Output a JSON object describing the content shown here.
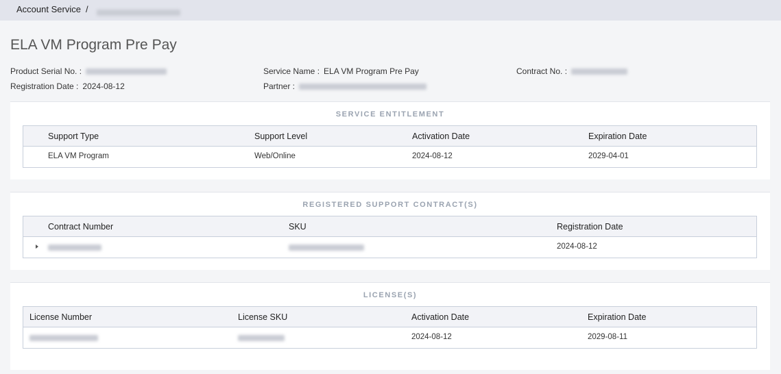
{
  "breadcrumb": {
    "root": "Account Service",
    "separator": "/"
  },
  "page_title": "ELA VM Program Pre Pay",
  "info": {
    "serial_label": "Product Serial No. :",
    "registration_label": "Registration Date :",
    "registration_value": "2024-08-12",
    "service_label": "Service Name :",
    "service_value": "ELA VM Program Pre Pay",
    "partner_label": "Partner :",
    "contract_label": "Contract No. :"
  },
  "entitlement": {
    "title": "SERVICE ENTITLEMENT",
    "headers": [
      "Support Type",
      "Support Level",
      "Activation Date",
      "Expiration Date"
    ],
    "rows": [
      [
        "ELA VM Program",
        "Web/Online",
        "2024-08-12",
        "2029-04-01"
      ]
    ]
  },
  "contracts": {
    "title": "REGISTERED SUPPORT CONTRACT(S)",
    "headers": [
      "Contract Number",
      "SKU",
      "Registration Date"
    ],
    "rows": [
      [
        "2024-08-12"
      ]
    ]
  },
  "licenses": {
    "title": "LICENSE(S)",
    "headers": [
      "License Number",
      "License SKU",
      "Activation Date",
      "Expiration Date"
    ],
    "rows": [
      [
        "2024-08-12",
        "2029-08-11"
      ]
    ]
  }
}
